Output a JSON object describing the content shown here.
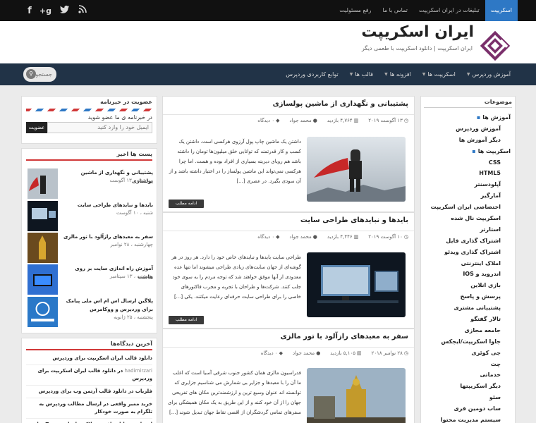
{
  "topbar": {
    "nav": [
      "اسکریپت",
      "تبلیغات در ایران اسکریپت",
      "تماس با ما",
      "رفع مسئولیت"
    ],
    "social_icons": [
      "rss-icon",
      "twitter-icon",
      "google-plus-icon",
      "facebook-icon"
    ]
  },
  "header": {
    "title": "ایران اسکریپت",
    "description": "ایران اسکریپت | دانلود اسکریپت با طعمی دیگر"
  },
  "mainnav": {
    "items": [
      "آموزش وردپرس",
      "اسکریپت ها",
      "افزونه ها",
      "قالب ها",
      "توابع کاربردی وردپرس"
    ],
    "search_placeholder": "جستجو"
  },
  "categories": {
    "title": "موضوعات",
    "items": [
      {
        "label": "آموزش ها",
        "level": 0
      },
      {
        "label": "آموزش وردپرس",
        "level": 1
      },
      {
        "label": "دیگر آموزش ها",
        "level": 1
      },
      {
        "label": "اسکریپت ها",
        "level": 0
      },
      {
        "label": "CSS",
        "level": 1
      },
      {
        "label": "HTML5",
        "level": 1
      },
      {
        "label": "آپلودسنتر",
        "level": 1
      },
      {
        "label": "آمارگیر",
        "level": 1
      },
      {
        "label": "اختصاصی ایران اسکریپت",
        "level": 1
      },
      {
        "label": "اسکریپت نال شده",
        "level": 1
      },
      {
        "label": "استارتر",
        "level": 1
      },
      {
        "label": "اشتراک گذاری فایل",
        "level": 1
      },
      {
        "label": "اشتراک گذاری ویدئو",
        "level": 1
      },
      {
        "label": "املاک اینترنتی",
        "level": 1
      },
      {
        "label": "اندروید و IOS",
        "level": 1
      },
      {
        "label": "بازی انلاین",
        "level": 1
      },
      {
        "label": "پرسش و پاسخ",
        "level": 1
      },
      {
        "label": "پشتیبانی مشتری",
        "level": 1
      },
      {
        "label": "تالار گفتگو",
        "level": 1
      },
      {
        "label": "جامعه مجازی",
        "level": 1
      },
      {
        "label": "جاوا اسکریپت/ایجکس",
        "level": 1
      },
      {
        "label": "جی کوئری",
        "level": 1
      },
      {
        "label": "چت",
        "level": 1
      },
      {
        "label": "خدماتی",
        "level": 1
      },
      {
        "label": "دیگر اسکریپتها",
        "level": 1
      },
      {
        "label": "سئو",
        "level": 1
      },
      {
        "label": "ساب دومین فری",
        "level": 1
      },
      {
        "label": "سیستم مدیریت محتوا",
        "level": 1
      }
    ]
  },
  "posts": [
    {
      "title": "پشتیبانی و نگهداری از ماشین پولسازی",
      "date": "۱۳ آگوست ۲۰۱۹",
      "views": "۴,۷۶۴ بازدید",
      "author": "محمد جواد",
      "comments": "۰ دیدگاه",
      "excerpt": "داشتن یک ماشین چاپ پول آرزوی هرکسی است. داشتن یک کسب و کار قدرتمند که توانایی خلق میلیون‌ها تومان را داشته باشد هم رویای دیرینه بسیاری از افراد بوده و هست. اما چرا هرکسی نمی‌تواند این ماشین پولساز را در اختیار داشته باشد و از آن سودی بگیرد. در عصری [...]",
      "more": "ادامه مطلب"
    },
    {
      "title": "بایدها و نبایدهای طراحی سایت",
      "date": "۱۰ آگوست ۲۰۱۹",
      "views": "۴,۴۴۶ بازدید",
      "author": "محمد جواد",
      "comments": "۰ دیدگاه",
      "excerpt": "طراحی سایت بایدها و نبایدهای خاص خود را دارد. هر روز در هر گوشه‌ای از جهان سایت‌های زیادی طراحی میشوند اما تنها عده معدودی از آنها موفق خواهند شد که توجه مردم را به سوی خود جلب کنند. شرکت‌ها و طراحان با تجربه و مجرب فاکتورهای خاصی را برای طراحی سایت حرفه‌ای رعایت میکنند. یکی [...]",
      "more": "ادامه مطلب"
    },
    {
      "title": "سفر به معبدهای رازآلود با تور مالزی",
      "date": "۲۸ نوامبر ۲۰۱۸",
      "views": "۵,۱۰۵ بازدید",
      "author": "محمد جواد",
      "comments": "۰ دیدگاه",
      "excerpt": "فدراسیون مالزی همان کشور جنوب شرقی آسیا است که اغلب ما آن را با معبدها و جزایر بی شمارش می شناسیم جزایری که توانسته اند عنوان وسیع ترین و ارزشمندترین مکان های تفریحی جهان را از آن خود کنند و از این طریق به یک مکان همیشگی برای سفرهای تمامی گردشگران از اقصی نقاط جهان تبدیل شوند [...]",
      "more": "ادامه مطلب"
    }
  ],
  "newsletter": {
    "title": "عضویت در خبرنامه",
    "text": "در خبرنامه ی ما عضو شوید",
    "input_placeholder": "ایمیل خود را وارد کنید",
    "button": "عضویت"
  },
  "recent_posts": {
    "title": "پست ها اخیر",
    "items": [
      {
        "title": "پشتیبانی و نگهداری از ماشین پولسازی",
        "date": "سه‌شنبه ، ۱۳ آگوست"
      },
      {
        "title": "بایدها و نبایدهای طراحی سایت",
        "date": "شنبه ، ۱۰ آگوست"
      },
      {
        "title": "سفر به معبدهای رازآلود با تور مالزی",
        "date": "چهارشنبه ، ۲۸ نوامبر"
      },
      {
        "title": "آموزش راه اندازی سایت بر روی هاست",
        "date": "پنجشنبه ، ۱۳ سپتامبر"
      },
      {
        "title": "پلاگین ارسال اس ام اس ملی پیامک برای وردپرس و ووکامرس",
        "date": "پنجشنبه ، ۲۵ ژانویه"
      }
    ]
  },
  "recent_comments": {
    "title": "آخرین دیدگاه‌ها",
    "items": [
      {
        "author": "",
        "text": "دانلود قالب ایران اسکریپت برای وردپرس"
      },
      {
        "author": "hadimirzari",
        "text": "در دانلود قالب ایران اسکریپت برای وردپرس"
      },
      {
        "author": "",
        "text": "فلزیاب در دانلود قالب آرتمن وب برای وردپرس"
      },
      {
        "author": "",
        "text": "خرید ممبر واقعی در ارسال مطالب وردپرس به تلگرام به صورت خودکار"
      },
      {
        "author": "",
        "text": "احسان در دانلود افزونه بلاکس اخبار Znews برای وردپرس"
      }
    ]
  }
}
